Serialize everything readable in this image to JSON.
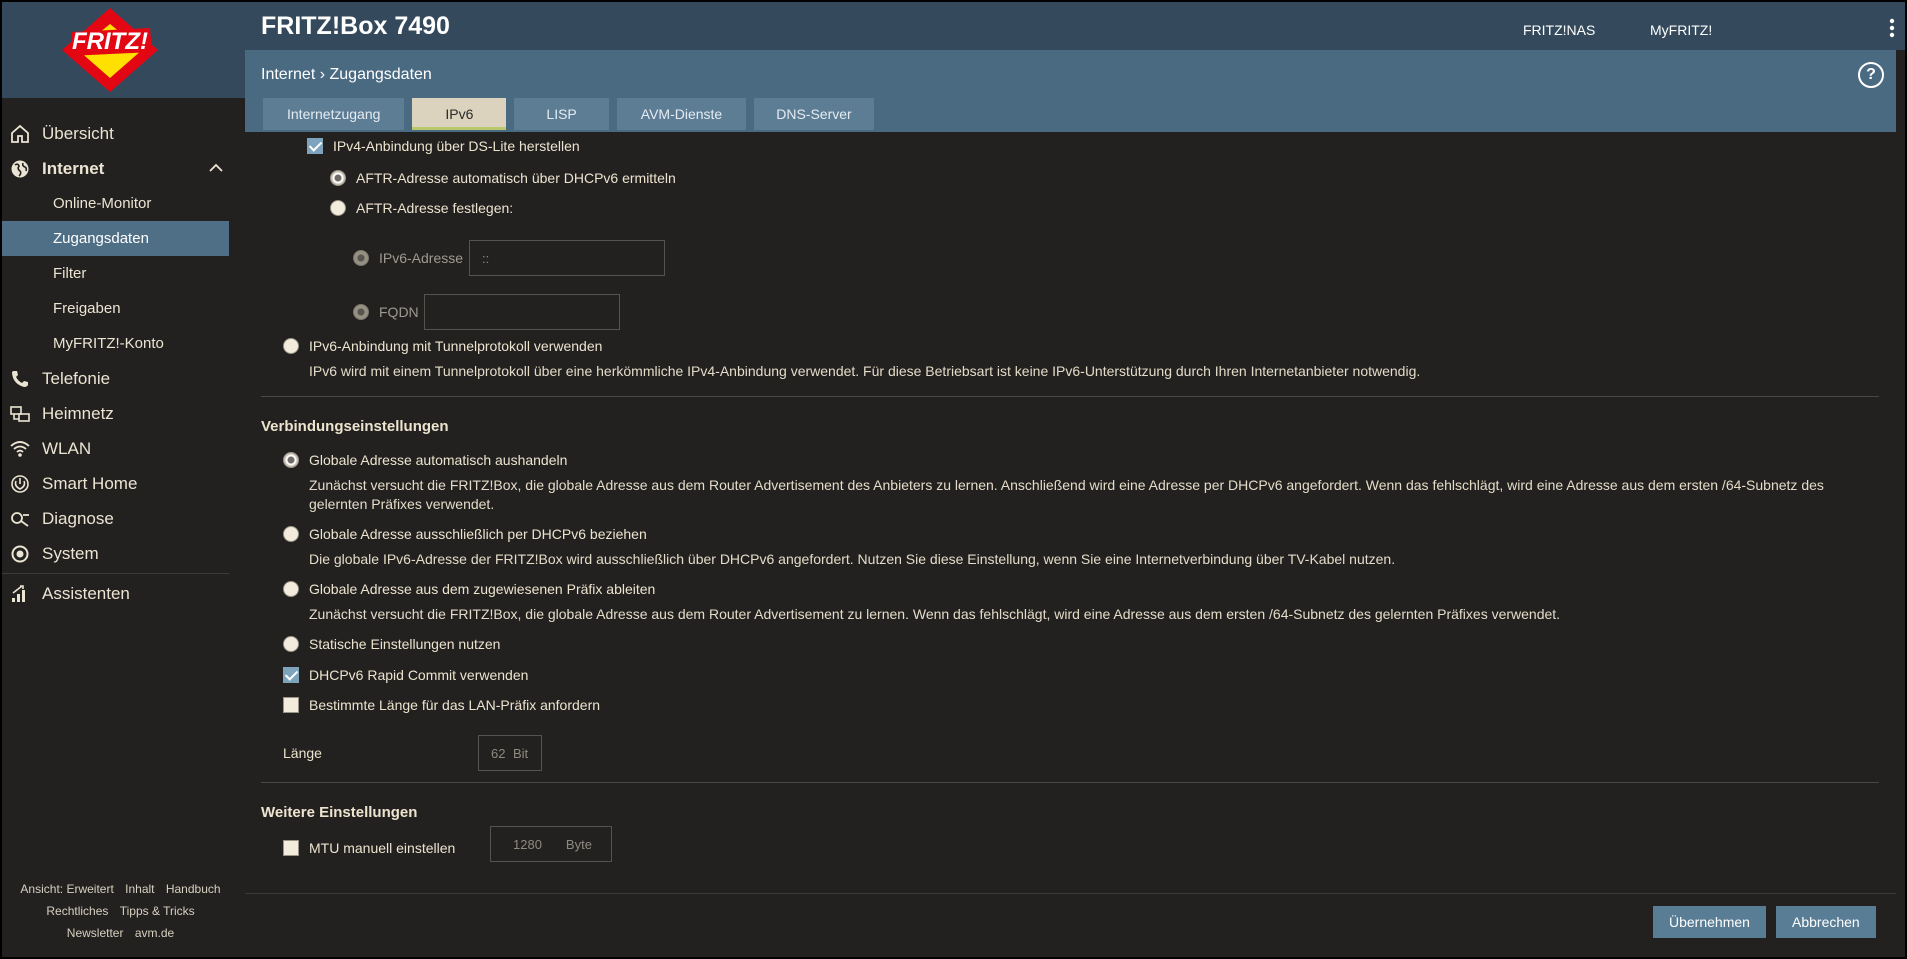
{
  "header": {
    "title": "FRITZ!Box 7490",
    "links": [
      "FRITZ!NAS",
      "MyFRITZ!"
    ],
    "breadcrumb_root": "Internet",
    "breadcrumb_sep": "›",
    "breadcrumb_current": "Zugangsdaten",
    "help": "?"
  },
  "tabs": [
    {
      "label": "Internetzugang",
      "active": false
    },
    {
      "label": "IPv6",
      "active": true
    },
    {
      "label": "LISP",
      "active": false
    },
    {
      "label": "AVM-Dienste",
      "active": false
    },
    {
      "label": "DNS-Server",
      "active": false
    }
  ],
  "sidebar": {
    "items": [
      {
        "label": "Übersicht",
        "icon": "home-icon"
      },
      {
        "label": "Internet",
        "icon": "globe-icon",
        "expanded": true
      },
      {
        "label": "Online-Monitor",
        "sub": true
      },
      {
        "label": "Zugangsdaten",
        "sub": true,
        "active": true
      },
      {
        "label": "Filter",
        "sub": true
      },
      {
        "label": "Freigaben",
        "sub": true
      },
      {
        "label": "MyFRITZ!-Konto",
        "sub": true
      },
      {
        "label": "Telefonie",
        "icon": "phone-icon"
      },
      {
        "label": "Heimnetz",
        "icon": "network-icon"
      },
      {
        "label": "WLAN",
        "icon": "wifi-icon"
      },
      {
        "label": "Smart Home",
        "icon": "smarthome-icon"
      },
      {
        "label": "Diagnose",
        "icon": "diagnose-icon"
      },
      {
        "label": "System",
        "icon": "system-icon"
      },
      {
        "label": "Assistenten",
        "icon": "wizard-icon"
      }
    ],
    "footer": {
      "row1": [
        "Ansicht: Erweitert",
        "Inhalt",
        "Handbuch"
      ],
      "row2": [
        "Rechtliches",
        "Tipps & Tricks"
      ],
      "row3": [
        "Newsletter",
        "avm.de"
      ]
    }
  },
  "content": {
    "dslite_checkbox": "IPv4-Anbindung über DS-Lite herstellen",
    "aftr_auto": "AFTR-Adresse automatisch über DHCPv6 ermitteln",
    "aftr_manual": "AFTR-Adresse festlegen:",
    "ipv6_address_label": "IPv6-Adresse",
    "ipv6_address_value": "::",
    "fqdn_label": "FQDN",
    "fqdn_value": "",
    "tunnel_label": "IPv6-Anbindung mit Tunnelprotokoll verwenden",
    "tunnel_desc": "IPv6 wird mit einem Tunnelprotokoll über eine herkömmliche IPv4-Anbindung verwendet. Für diese Betriebsart ist keine IPv6-Unterstützung durch Ihren Internetanbieter notwendig.",
    "connection_title": "Verbindungseinstellungen",
    "global_auto_label": "Globale Adresse automatisch aushandeln",
    "global_auto_desc": "Zunächst versucht die FRITZ!Box, die globale Adresse aus dem Router Advertisement des Anbieters zu lernen. Anschließend wird eine Adresse per DHCPv6 angefordert. Wenn das fehlschlägt, wird eine Adresse aus dem ersten /64-Subnetz des gelernten Präfixes verwendet.",
    "global_dhcp_label": "Globale Adresse ausschließlich per DHCPv6 beziehen",
    "global_dhcp_desc": "Die globale IPv6-Adresse der FRITZ!Box wird ausschließlich über DHCPv6 angefordert. Nutzen Sie diese Einstellung, wenn Sie eine Internetverbindung über TV-Kabel nutzen.",
    "global_prefix_label": "Globale Adresse aus dem zugewiesenen Präfix ableiten",
    "global_prefix_desc": "Zunächst versucht die FRITZ!Box, die globale Adresse aus dem Router Advertisement zu lernen. Wenn das fehlschlägt, wird eine Adresse aus dem ersten /64-Subnetz des gelernten Präfixes verwendet.",
    "static_label": "Statische Einstellungen nutzen",
    "rapid_commit_label": "DHCPv6 Rapid Commit verwenden",
    "prefix_length_label": "Bestimmte Länge für das LAN-Präfix anfordern",
    "length_label": "Länge",
    "length_value": "62",
    "length_unit": "Bit",
    "more_title": "Weitere Einstellungen",
    "mtu_label": "MTU manuell einstellen",
    "mtu_value": "1280",
    "mtu_unit": "Byte"
  },
  "buttons": {
    "apply": "Übernehmen",
    "cancel": "Abbrechen"
  },
  "colors": {
    "header": "#34495b",
    "subbar": "#4a6a82",
    "active_nav": "#4f6f86",
    "background": "#222120",
    "button": "#5a7d96"
  }
}
